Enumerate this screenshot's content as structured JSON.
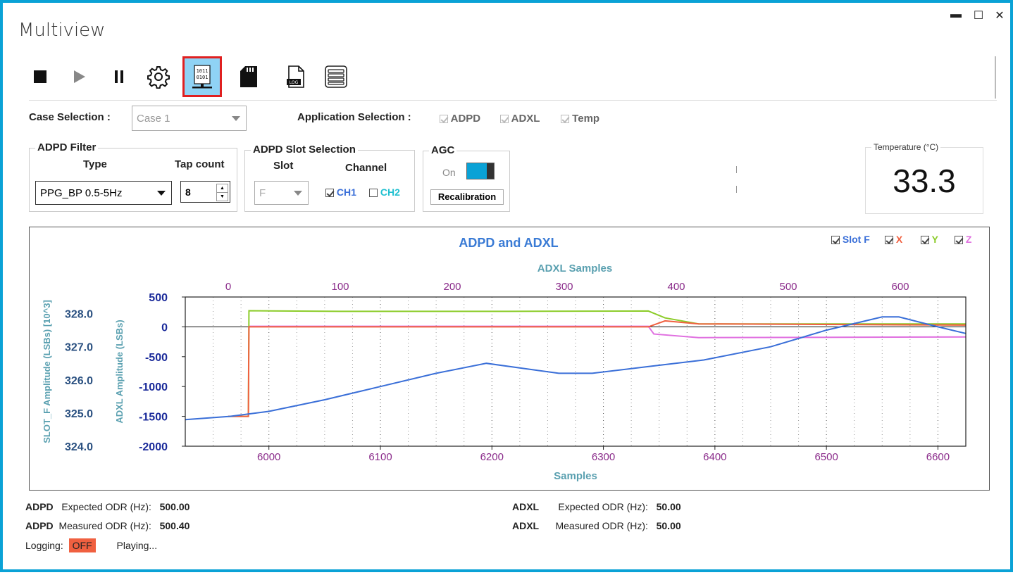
{
  "window": {
    "title": "Multiview",
    "minimize": "▬",
    "maximize": "☐",
    "close": "✕"
  },
  "toolbar": {
    "items": [
      "stop-icon",
      "play-icon",
      "pause-icon",
      "gear-icon",
      "binary-data-icon",
      "sd-card-icon",
      "log-file-icon",
      "list-icon"
    ],
    "binary_top": "1011",
    "binary_bottom": "0101",
    "log_text": "LOG"
  },
  "case": {
    "label": "Case Selection :",
    "value": "Case 1"
  },
  "application": {
    "label": "Application Selection :",
    "options": [
      "ADPD",
      "ADXL",
      "Temp"
    ]
  },
  "adpd_filter": {
    "title": "ADPD Filter",
    "type_label": "Type",
    "tap_label": "Tap count",
    "type_value": "PPG_BP 0.5-5Hz",
    "tap_value": "8"
  },
  "slot_selection": {
    "title": "ADPD Slot Selection",
    "slot_label": "Slot",
    "channel_label": "Channel",
    "slot_value": "F",
    "ch1": "CH1",
    "ch2": "CH2"
  },
  "agc": {
    "title": "AGC",
    "state": "On",
    "recal": "Recalibration"
  },
  "temperature": {
    "title": "Temperature (°C)",
    "value": "33.3"
  },
  "chart_legend": {
    "slot_f": "Slot F",
    "x": "X",
    "y": "Y",
    "z": "Z"
  },
  "colors": {
    "slot_f": "#3a6fd8",
    "x": "#f06040",
    "y": "#8ccc2a",
    "z": "#e070e0",
    "accent": "#0aa2d6"
  },
  "chart_data": {
    "type": "line",
    "title": "ADPD and ADXL",
    "top_xlabel": "ADXL Samples",
    "xlabel": "Samples",
    "left_ylabel": "SLOT_F Amplitude (LSBs) [10^3]",
    "right_ylabel": "ADXL Amplitude (LSBs)",
    "x_range": [
      5925,
      6625
    ],
    "x_ticks": [
      "6000",
      "6100",
      "6200",
      "6300",
      "6400",
      "6500",
      "6600"
    ],
    "top_range": [
      0,
      660
    ],
    "top_ticks": [
      "0",
      "100",
      "200",
      "300",
      "400",
      "500",
      "600"
    ],
    "slot_ylim": [
      324.0,
      328.5
    ],
    "slot_ticks": [
      "324.0",
      "325.0",
      "326.0",
      "327.0",
      "328.0"
    ],
    "adxl_ylim": [
      -2000,
      500
    ],
    "adxl_ticks": [
      "-2000",
      "-1500",
      "-1000",
      "-500",
      "0",
      "500"
    ],
    "series": [
      {
        "name": "Slot F",
        "axis": "slot",
        "x": [
          5925,
          5965,
          6000,
          6050,
          6100,
          6150,
          6195,
          6260,
          6290,
          6340,
          6390,
          6450,
          6500,
          6550,
          6565,
          6600,
          6625
        ],
        "y": [
          324.8,
          324.9,
          325.05,
          325.4,
          325.8,
          326.2,
          326.5,
          326.2,
          326.2,
          326.4,
          326.6,
          327.0,
          327.5,
          327.9,
          327.9,
          327.6,
          327.4
        ]
      },
      {
        "name": "X",
        "axis": "adxl",
        "x": [
          0,
          18,
          18.5,
          100,
          250,
          375,
          390,
          420,
          660
        ],
        "y": [
          -1500,
          -1500,
          0,
          0,
          0,
          0,
          100,
          50,
          30
        ]
      },
      {
        "name": "Y",
        "axis": "adxl",
        "x": [
          0,
          18,
          18.5,
          100,
          250,
          375,
          390,
          420,
          660
        ],
        "y": [
          -1500,
          -1500,
          270,
          260,
          260,
          265,
          150,
          50,
          50
        ]
      },
      {
        "name": "Z",
        "axis": "adxl",
        "x": [
          18,
          100,
          250,
          375,
          380,
          420,
          660
        ],
        "y": [
          10,
          10,
          10,
          10,
          -120,
          -180,
          -170
        ]
      }
    ],
    "grid": true,
    "legend_position": "top-right"
  },
  "footer": {
    "adpd": "ADPD",
    "adxl": "ADXL",
    "expected_label": "Expected ODR (Hz):",
    "measured_label": "Measured ODR (Hz):",
    "adpd_expected": "500.00",
    "adpd_measured": "500.40",
    "adxl_expected": "50.00",
    "adxl_measured": "50.00",
    "logging_label": "Logging:",
    "logging_value": "OFF",
    "status": "Playing..."
  }
}
